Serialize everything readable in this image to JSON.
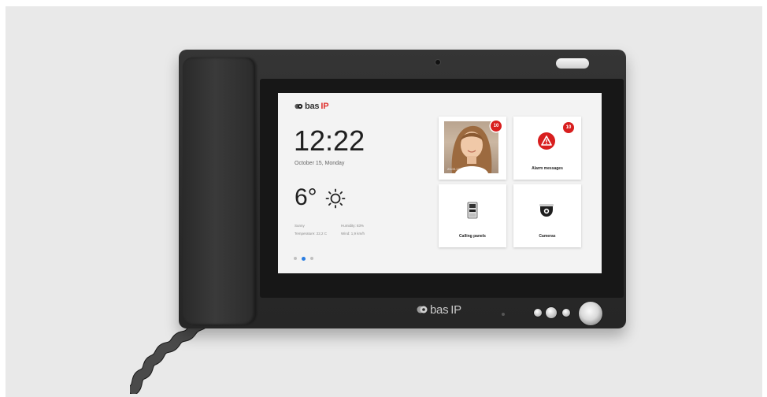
{
  "device": {
    "brand_text": "bas",
    "brand_ip": "IP",
    "bottom_brand_text": "bas",
    "bottom_brand_ip": "IP"
  },
  "screen": {
    "time": "12:22",
    "date": "October 15, Monday",
    "weather": {
      "temperature": "6°",
      "condition": "Sunny",
      "temperature_detail": "Temperature: 22,2 C",
      "humidity": "Humidity: 83%",
      "wind": "Wind: 1,9 km/h",
      "icon": "sun-icon"
    },
    "pager": {
      "pages": 3,
      "active_index": 1
    },
    "tiles": [
      {
        "label": "",
        "badge": "10",
        "icon": "visitor-photo",
        "timestamp": "23.09.17 12:00"
      },
      {
        "label": "Alarm messages",
        "badge": "10",
        "icon": "alarm-warning-icon"
      },
      {
        "label": "Calling panels",
        "badge": "",
        "icon": "intercom-panel-icon"
      },
      {
        "label": "Cameras",
        "badge": "",
        "icon": "dome-camera-icon"
      }
    ]
  },
  "colors": {
    "accent_blue": "#2a7de1",
    "badge_red": "#d81e1e",
    "brand_red": "#e0322f",
    "device_body": "#2e2e2e"
  }
}
